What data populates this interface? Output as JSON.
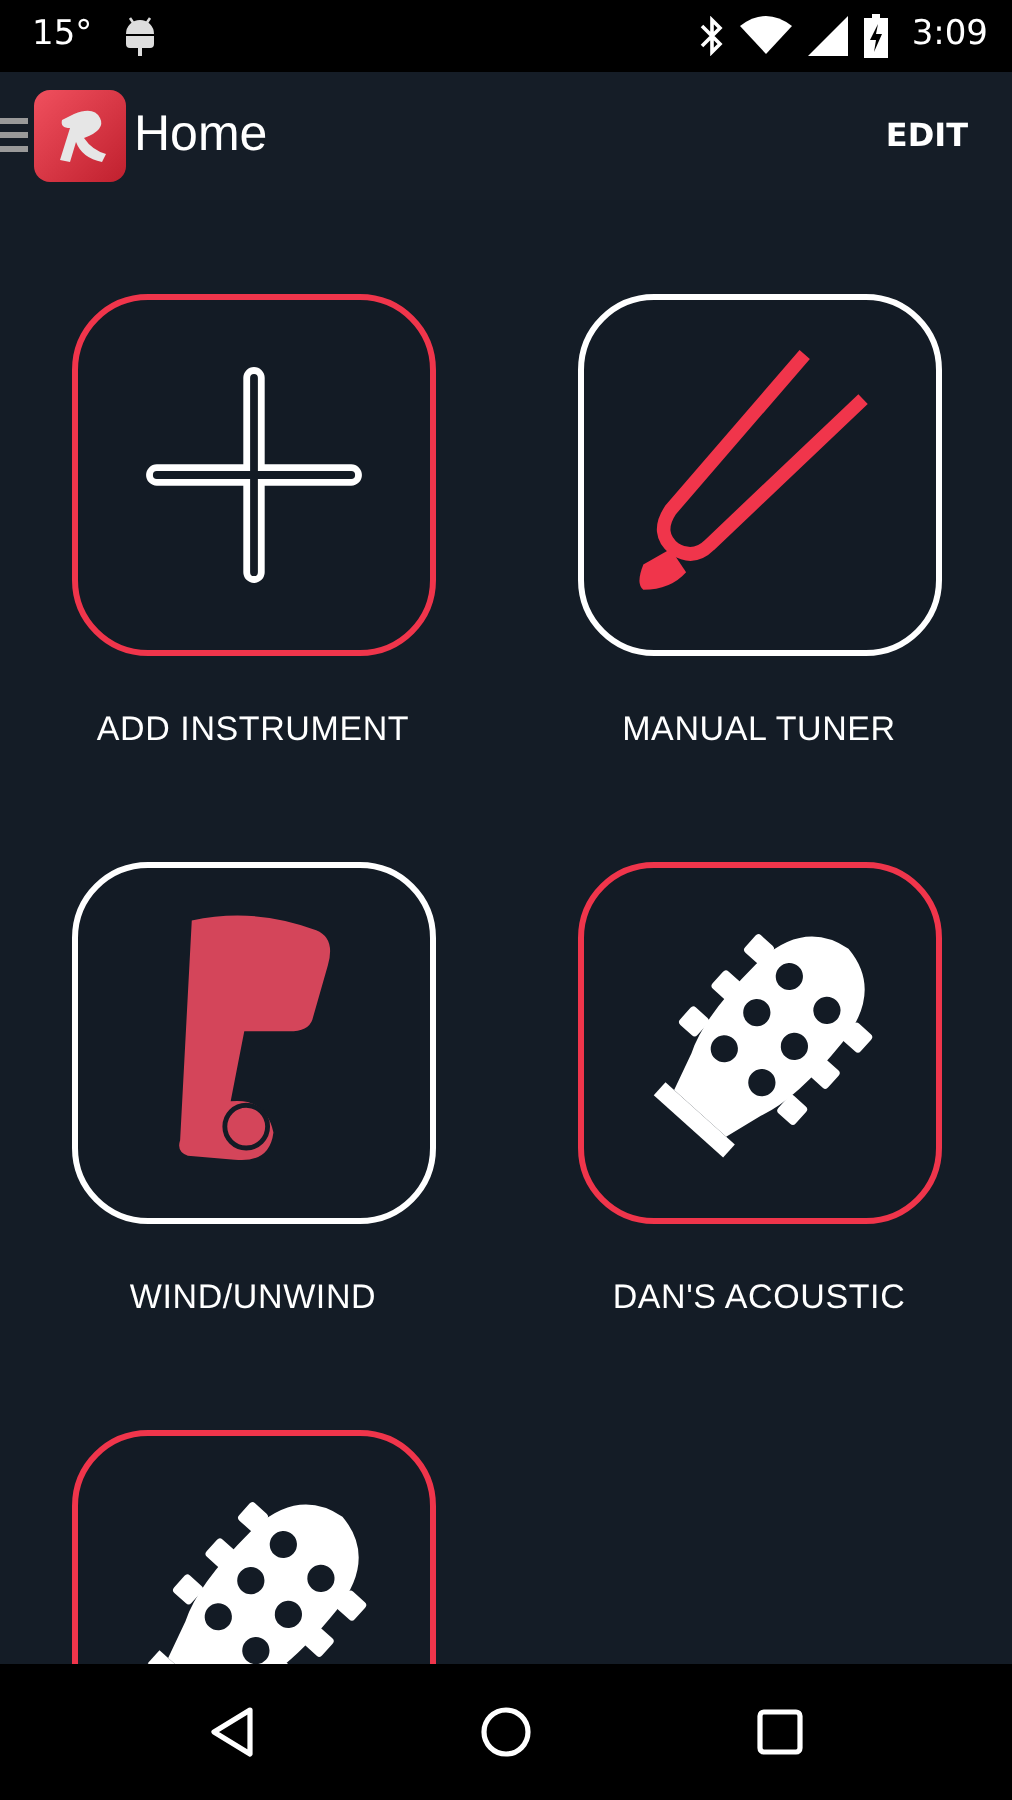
{
  "status_bar": {
    "temperature": "15°",
    "time": "3:09"
  },
  "app_bar": {
    "title": "Home",
    "action": "EDIT"
  },
  "tiles": [
    {
      "label": "ADD INSTRUMENT",
      "kind": "add",
      "color": "#f0354b"
    },
    {
      "label": "MANUAL TUNER",
      "kind": "tuner",
      "color": "#ffffff"
    },
    {
      "label": "WIND/UNWIND",
      "kind": "peg",
      "color": "#ffffff"
    },
    {
      "label": "DAN'S ACOUSTIC",
      "kind": "headstock",
      "color": "#f0354b"
    },
    {
      "kind": "headstock",
      "color": "#f0354b"
    }
  ]
}
